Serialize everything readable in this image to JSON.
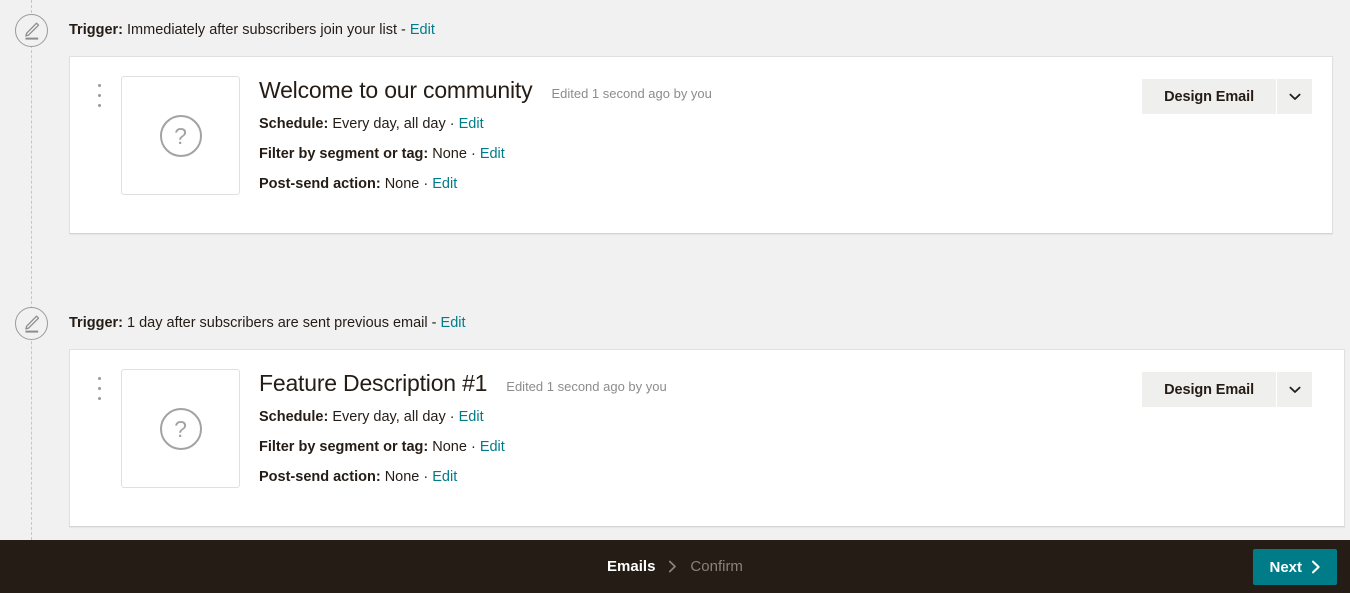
{
  "steps": [
    {
      "icon_name": "edit-pencil-icon",
      "trigger_label": "Trigger:",
      "trigger_value": "Immediately after subscribers join your list",
      "trigger_separator": "-",
      "trigger_edit": "Edit",
      "card": {
        "menu_icon": "kebab-menu-icon",
        "thumbnail_icon": "question-mark-placeholder-icon",
        "thumbnail_glyph": "?",
        "title": "Welcome to our community",
        "edited": "Edited 1 second ago by you",
        "meta": [
          {
            "label": "Schedule:",
            "value": "Every day, all day",
            "sep": "·",
            "edit": "Edit"
          },
          {
            "label": "Filter by segment or tag:",
            "value": "None",
            "sep": "·",
            "edit": "Edit"
          },
          {
            "label": "Post-send action:",
            "value": "None",
            "sep": "·",
            "edit": "Edit"
          }
        ],
        "action_button": "Design Email",
        "action_caret_icon": "chevron-down-icon"
      }
    },
    {
      "icon_name": "edit-pencil-icon",
      "trigger_label": "Trigger:",
      "trigger_value": "1 day after subscribers are sent previous email",
      "trigger_separator": "-",
      "trigger_edit": "Edit",
      "card": {
        "menu_icon": "kebab-menu-icon",
        "thumbnail_icon": "question-mark-placeholder-icon",
        "thumbnail_glyph": "?",
        "title": "Feature Description #1",
        "edited": "Edited 1 second ago by you",
        "meta": [
          {
            "label": "Schedule:",
            "value": "Every day, all day",
            "sep": "·",
            "edit": "Edit"
          },
          {
            "label": "Filter by segment or tag:",
            "value": "None",
            "sep": "·",
            "edit": "Edit"
          },
          {
            "label": "Post-send action:",
            "value": "None",
            "sep": "·",
            "edit": "Edit"
          }
        ],
        "action_button": "Design Email",
        "action_caret_icon": "chevron-down-icon"
      }
    }
  ],
  "footer": {
    "breadcrumb": [
      {
        "label": "Emails",
        "state": "active"
      },
      {
        "label": "Confirm",
        "state": "inactive"
      }
    ],
    "breadcrumb_separator_icon": "chevron-right-icon",
    "next_label": "Next",
    "next_icon": "chevron-right-icon"
  },
  "colors": {
    "page_background": "#f1f1f1",
    "card_background": "#ffffff",
    "link": "#007c89",
    "accent": "#007c89",
    "footer_background": "#241c15",
    "button_face": "#efefed",
    "text": "#241c15",
    "muted_text": "#8c8c8c"
  }
}
